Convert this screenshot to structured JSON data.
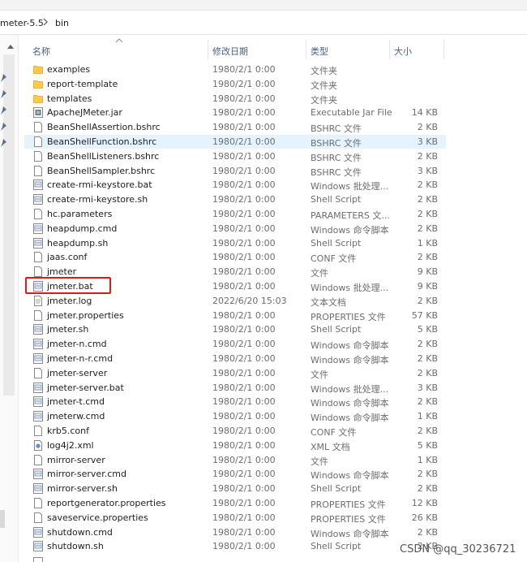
{
  "breadcrumb": {
    "parent": "meter-5.5",
    "current": "bin"
  },
  "columns": {
    "name": "名称",
    "date": "修改日期",
    "type": "类型",
    "size": "大小"
  },
  "files": [
    {
      "name": "examples",
      "date": "1980/2/1 0:00",
      "type": "文件夹",
      "size": "",
      "icon": "folder-icon"
    },
    {
      "name": "report-template",
      "date": "1980/2/1 0:00",
      "type": "文件夹",
      "size": "",
      "icon": "folder-icon"
    },
    {
      "name": "templates",
      "date": "1980/2/1 0:00",
      "type": "文件夹",
      "size": "",
      "icon": "folder-icon"
    },
    {
      "name": "ApacheJMeter.jar",
      "date": "1980/2/1 0:00",
      "type": "Executable Jar File",
      "size": "14 KB",
      "icon": "jar-file-icon"
    },
    {
      "name": "BeanShellAssertion.bshrc",
      "date": "1980/2/1 0:00",
      "type": "BSHRC 文件",
      "size": "2 KB",
      "icon": "file-icon"
    },
    {
      "name": "BeanShellFunction.bshrc",
      "date": "1980/2/1 0:00",
      "type": "BSHRC 文件",
      "size": "3 KB",
      "icon": "file-icon"
    },
    {
      "name": "BeanShellListeners.bshrc",
      "date": "1980/2/1 0:00",
      "type": "BSHRC 文件",
      "size": "2 KB",
      "icon": "file-icon"
    },
    {
      "name": "BeanShellSampler.bshrc",
      "date": "1980/2/1 0:00",
      "type": "BSHRC 文件",
      "size": "3 KB",
      "icon": "file-icon"
    },
    {
      "name": "create-rmi-keystore.bat",
      "date": "1980/2/1 0:00",
      "type": "Windows 批处理...",
      "size": "2 KB",
      "icon": "script-file-icon"
    },
    {
      "name": "create-rmi-keystore.sh",
      "date": "1980/2/1 0:00",
      "type": "Shell Script",
      "size": "2 KB",
      "icon": "script-file-icon"
    },
    {
      "name": "hc.parameters",
      "date": "1980/2/1 0:00",
      "type": "PARAMETERS 文...",
      "size": "2 KB",
      "icon": "file-icon"
    },
    {
      "name": "heapdump.cmd",
      "date": "1980/2/1 0:00",
      "type": "Windows 命令脚本",
      "size": "2 KB",
      "icon": "script-file-icon"
    },
    {
      "name": "heapdump.sh",
      "date": "1980/2/1 0:00",
      "type": "Shell Script",
      "size": "1 KB",
      "icon": "script-file-icon"
    },
    {
      "name": "jaas.conf",
      "date": "1980/2/1 0:00",
      "type": "CONF 文件",
      "size": "2 KB",
      "icon": "file-icon"
    },
    {
      "name": "jmeter",
      "date": "1980/2/1 0:00",
      "type": "文件",
      "size": "9 KB",
      "icon": "file-icon"
    },
    {
      "name": "jmeter.bat",
      "date": "1980/2/1 0:00",
      "type": "Windows 批处理...",
      "size": "9 KB",
      "icon": "script-file-icon"
    },
    {
      "name": "jmeter.log",
      "date": "2022/6/20 15:03",
      "type": "文本文档",
      "size": "2 KB",
      "icon": "text-file-icon"
    },
    {
      "name": "jmeter.properties",
      "date": "1980/2/1 0:00",
      "type": "PROPERTIES 文件",
      "size": "57 KB",
      "icon": "file-icon"
    },
    {
      "name": "jmeter.sh",
      "date": "1980/2/1 0:00",
      "type": "Shell Script",
      "size": "5 KB",
      "icon": "script-file-icon"
    },
    {
      "name": "jmeter-n.cmd",
      "date": "1980/2/1 0:00",
      "type": "Windows 命令脚本",
      "size": "2 KB",
      "icon": "script-file-icon"
    },
    {
      "name": "jmeter-n-r.cmd",
      "date": "1980/2/1 0:00",
      "type": "Windows 命令脚本",
      "size": "2 KB",
      "icon": "script-file-icon"
    },
    {
      "name": "jmeter-server",
      "date": "1980/2/1 0:00",
      "type": "文件",
      "size": "2 KB",
      "icon": "file-icon"
    },
    {
      "name": "jmeter-server.bat",
      "date": "1980/2/1 0:00",
      "type": "Windows 批处理...",
      "size": "3 KB",
      "icon": "script-file-icon"
    },
    {
      "name": "jmeter-t.cmd",
      "date": "1980/2/1 0:00",
      "type": "Windows 命令脚本",
      "size": "2 KB",
      "icon": "script-file-icon"
    },
    {
      "name": "jmeterw.cmd",
      "date": "1980/2/1 0:00",
      "type": "Windows 命令脚本",
      "size": "1 KB",
      "icon": "script-file-icon"
    },
    {
      "name": "krb5.conf",
      "date": "1980/2/1 0:00",
      "type": "CONF 文件",
      "size": "2 KB",
      "icon": "file-icon"
    },
    {
      "name": "log4j2.xml",
      "date": "1980/2/1 0:00",
      "type": "XML 文档",
      "size": "5 KB",
      "icon": "xml-file-icon"
    },
    {
      "name": "mirror-server",
      "date": "1980/2/1 0:00",
      "type": "文件",
      "size": "1 KB",
      "icon": "file-icon"
    },
    {
      "name": "mirror-server.cmd",
      "date": "1980/2/1 0:00",
      "type": "Windows 命令脚本",
      "size": "2 KB",
      "icon": "script-file-icon"
    },
    {
      "name": "mirror-server.sh",
      "date": "1980/2/1 0:00",
      "type": "Shell Script",
      "size": "2 KB",
      "icon": "script-file-icon"
    },
    {
      "name": "reportgenerator.properties",
      "date": "1980/2/1 0:00",
      "type": "PROPERTIES 文件",
      "size": "12 KB",
      "icon": "file-icon"
    },
    {
      "name": "saveservice.properties",
      "date": "1980/2/1 0:00",
      "type": "PROPERTIES 文件",
      "size": "26 KB",
      "icon": "file-icon"
    },
    {
      "name": "shutdown.cmd",
      "date": "1980/2/1 0:00",
      "type": "Windows 命令脚本",
      "size": "2 KB",
      "icon": "script-file-icon"
    },
    {
      "name": "shutdown.sh",
      "date": "1980/2/1 0:00",
      "type": "Shell Script",
      "size": "2 KB",
      "icon": "script-file-icon"
    }
  ],
  "highlighted_file": "BeanShellFunction.bshrc",
  "annotated_file": "jmeter.bat",
  "watermark": "CSDN @qq_30236721",
  "colors": {
    "highlight": "#e5f3ff",
    "annotation": "#e0191b",
    "folder": "#ffcb47"
  }
}
